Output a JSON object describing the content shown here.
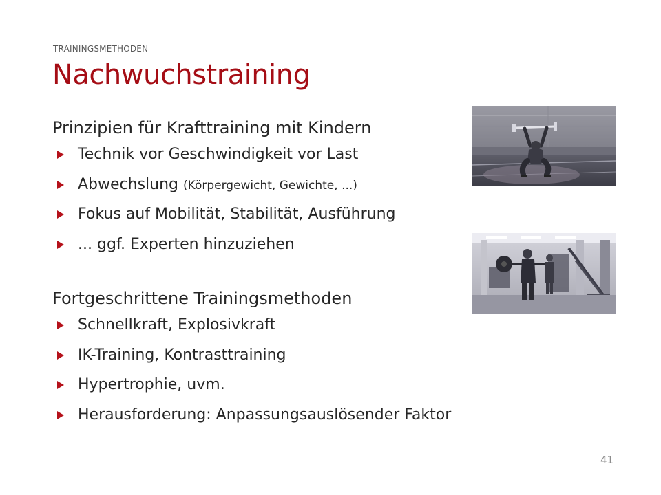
{
  "slide": {
    "kicker": "TRAININGSMETHODEN",
    "title": "Nachwuchstraining",
    "page_number": "41",
    "accent_color": "#a50d15",
    "bullet_color": "#b5121b"
  },
  "sections": [
    {
      "heading": "Prinzipien für Krafttraining mit Kindern",
      "bullets": [
        {
          "text": "Technik vor Geschwindigkeit vor Last"
        },
        {
          "text": "Abwechslung",
          "note": "(Körpergewicht, Gewichte, ...)"
        },
        {
          "text": "Fokus auf Mobilität, Stabilität, Ausführung"
        },
        {
          "text": "... ggf. Experten hinzuziehen"
        }
      ]
    },
    {
      "heading": "Fortgeschrittene Trainingsmethoden",
      "bullets": [
        {
          "text": "Schnellkraft, Explosivkraft"
        },
        {
          "text": "IK-Training, Kontrasttraining"
        },
        {
          "text": "Hypertrophie, uvm."
        },
        {
          "text": "Herausforderung: Anpassungsauslösender Faktor"
        }
      ]
    }
  ],
  "photos": [
    {
      "icon": "overhead-squat-photo"
    },
    {
      "icon": "gym-weightlifting-photo"
    }
  ]
}
